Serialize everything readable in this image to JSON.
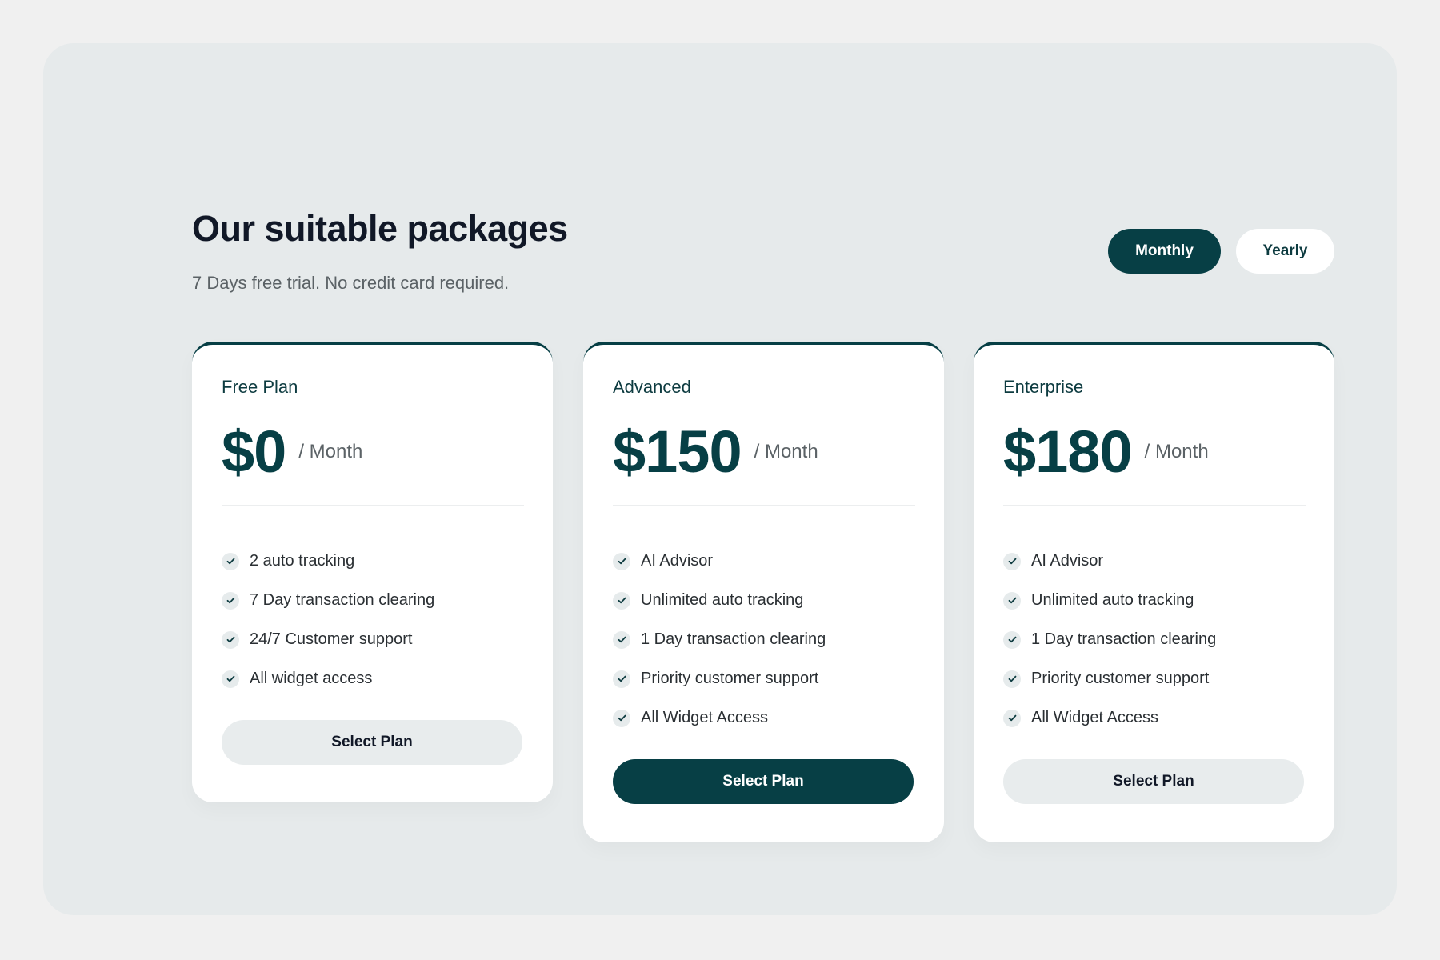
{
  "header": {
    "title": "Our suitable packages",
    "subtitle": "7 Days free trial. No credit card required."
  },
  "billing_toggle": {
    "options": [
      "Monthly",
      "Yearly"
    ],
    "selected": "Monthly"
  },
  "plans": [
    {
      "name": "Free Plan",
      "price": "$0",
      "period": "/ Month",
      "features": [
        "2 auto tracking",
        "7 Day transaction clearing",
        "24/7 Customer support",
        "All widget access"
      ],
      "button_label": "Select Plan",
      "highlighted": false
    },
    {
      "name": "Advanced",
      "price": "$150",
      "period": "/ Month",
      "features": [
        "AI Advisor",
        "Unlimited auto tracking",
        "1 Day transaction clearing",
        "Priority customer support",
        "All Widget Access"
      ],
      "button_label": "Select Plan",
      "highlighted": true
    },
    {
      "name": "Enterprise",
      "price": "$180",
      "period": "/ Month",
      "features": [
        "AI Advisor",
        "Unlimited auto tracking",
        "1 Day transaction clearing",
        "Priority customer support",
        "All Widget Access"
      ],
      "button_label": "Select Plan",
      "highlighted": false
    }
  ],
  "icons": {
    "feature_bullet": "check-icon"
  },
  "colors": {
    "accent": "#073f45",
    "background": "#e6eaeb",
    "card": "#ffffff",
    "button_secondary": "#e8eced"
  }
}
